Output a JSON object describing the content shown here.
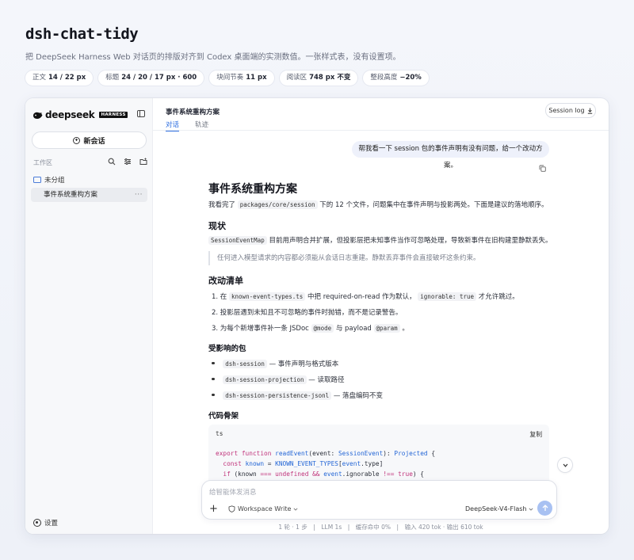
{
  "page": {
    "title": "dsh-chat-tidy",
    "description": "把 DeepSeek Harness Web 对话页的排版对齐到 Codex 桌面端的实测数值。一张样式表，没有设置项。",
    "chips": [
      {
        "label": "正文",
        "value": "14 / 22 px"
      },
      {
        "label": "标题",
        "value": "24 / 20 / 17 px · 600"
      },
      {
        "label": "块间节奏",
        "value": "11 px"
      },
      {
        "label": "阅读区",
        "value": "748 px 不变"
      },
      {
        "label": "整段高度",
        "value": "−20%"
      }
    ]
  },
  "sidebar": {
    "logo_text": "deepseek",
    "logo_badge": "HARNESS",
    "new_chat": "新会话",
    "workspace_label": "工作区",
    "group": "未分组",
    "session": "事件系统重构方案",
    "session_more": "···",
    "settings": "设置"
  },
  "header": {
    "title": "事件系统重构方案",
    "tabs": [
      "对话",
      "轨迹"
    ],
    "session_log": "Session log"
  },
  "chat": {
    "user_message": "帮我看一下 session 包的事件声明有没有问题，给一个改动方案。",
    "doc": {
      "h1": "事件系统重构方案",
      "intro_a": "我看完了",
      "intro_code": "packages/core/session",
      "intro_b": "下的 12 个文件，问题集中在事件声明与投影两处。下面是建议的落地顺序。",
      "h2_status": "现状",
      "status_code": "SessionEventMap",
      "status_text": "目前用声明合并扩展，但投影层把未知事件当作可忽略处理，导致新事件在旧构建里静默丢失。",
      "quote": "任何进入模型请求的内容都必须能从会话日志重建。静默丢弃事件会直接破坏这条约束。",
      "h2_changes": "改动清单",
      "change1_a": "1. 在",
      "change1_code1": "known-event-types.ts",
      "change1_b": "中把 required-on-read 作为默认，",
      "change1_code2": "ignorable: true",
      "change1_c": "才允许跳过。",
      "change2": "2. 投影层遇到未知且不可忽略的事件时抛错，而不是记录警告。",
      "change3_a": "3. 为每个新增事件补一条 JSDoc",
      "change3_code1": "@mode",
      "change3_b": "与 payload",
      "change3_code2": "@param",
      "change3_c": "。",
      "h3_affected": "受影响的包",
      "pkg1_code": "dsh-session",
      "pkg1_text": "— 事件声明与格式版本",
      "pkg2_code": "dsh-session-projection",
      "pkg2_text": "— 读取路径",
      "pkg3_code": "dsh-session-persistence-jsonl",
      "pkg3_text": "— 落盘编码不变",
      "h2_code": "代码骨架",
      "code_lang": "ts",
      "code_copy": "复制"
    }
  },
  "composer": {
    "placeholder": "给智能体发消息",
    "plus": "+",
    "workspace": "Workspace Write",
    "model": "DeepSeek-V4-Flash"
  },
  "status_line": "1 轮 · 1 步　|　LLM 1s　|　缓存命中 0%　|　输入 420 tok · 输出 610 tok",
  "colors": {
    "accent": "#2f6fe0",
    "send_button": "#a8c1f2",
    "keyword": "#c0327a"
  }
}
